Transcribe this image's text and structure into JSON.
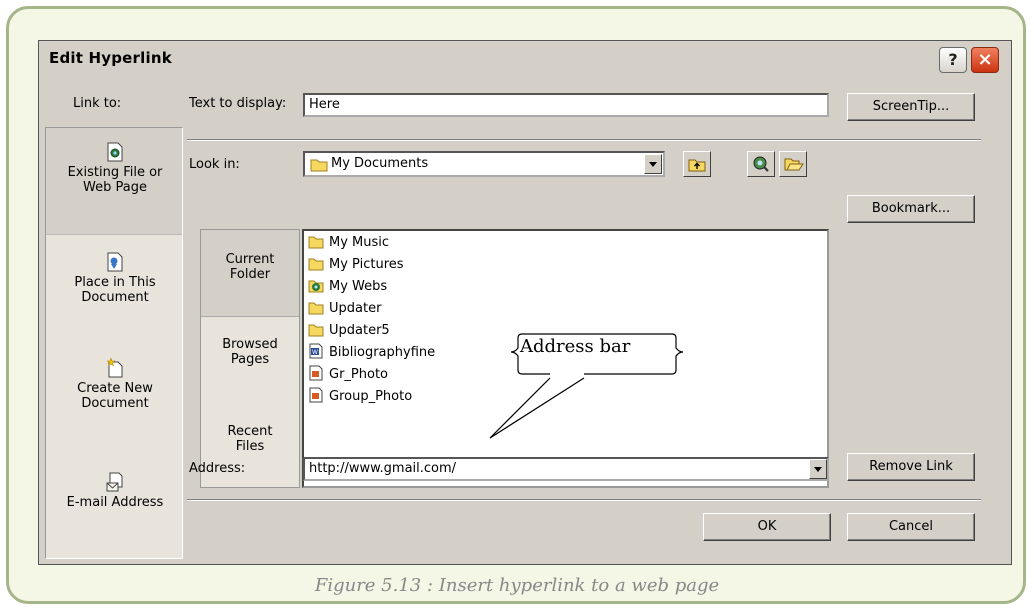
{
  "caption": "Figure 5.13 : Insert hyperlink to a web page",
  "dialog": {
    "title": "Edit Hyperlink",
    "help_label": "?",
    "close_label": "×",
    "link_to_label": "Link to:",
    "text_to_display_label": "Text to display:",
    "text_to_display_value": "Here",
    "look_in_label": "Look in:",
    "look_in_value": "My Documents",
    "address_label": "Address:",
    "address_value": "http://www.gmail.com/",
    "link_to_items": [
      {
        "line1": "Existing File or",
        "line2": "Web Page",
        "icon": "existing-file-icon"
      },
      {
        "line1": "Place in This",
        "line2": "Document",
        "icon": "place-in-document-icon"
      },
      {
        "line1": "Create New",
        "line2": "Document",
        "icon": "create-new-document-icon"
      },
      {
        "line1": "E-mail Address",
        "line2": "",
        "icon": "email-address-icon"
      }
    ],
    "view_tabs": [
      {
        "line1": "Current",
        "line2": "Folder"
      },
      {
        "line1": "Browsed",
        "line2": "Pages"
      },
      {
        "line1": "Recent",
        "line2": "Files"
      }
    ],
    "files": [
      {
        "name": "My Music",
        "icon": "folder-icon"
      },
      {
        "name": "My Pictures",
        "icon": "folder-icon"
      },
      {
        "name": "My Webs",
        "icon": "webs-folder-icon"
      },
      {
        "name": "Updater",
        "icon": "folder-icon"
      },
      {
        "name": "Updater5",
        "icon": "folder-icon"
      },
      {
        "name": "Bibliographyfine",
        "icon": "word-document-icon"
      },
      {
        "name": "Gr_Photo",
        "icon": "image-file-icon"
      },
      {
        "name": "Group_Photo",
        "icon": "image-file-icon"
      }
    ],
    "buttons": {
      "screentip": "ScreenTip...",
      "bookmark": "Bookmark...",
      "remove_link": "Remove Link",
      "ok": "OK",
      "cancel": "Cancel"
    }
  },
  "callout": {
    "text": "Address bar"
  },
  "colors": {
    "dialog_face": "#d4d0c8",
    "frame_border": "#a4b688",
    "frame_bg": "#f4f6e6",
    "close_button": "#cc3310"
  }
}
